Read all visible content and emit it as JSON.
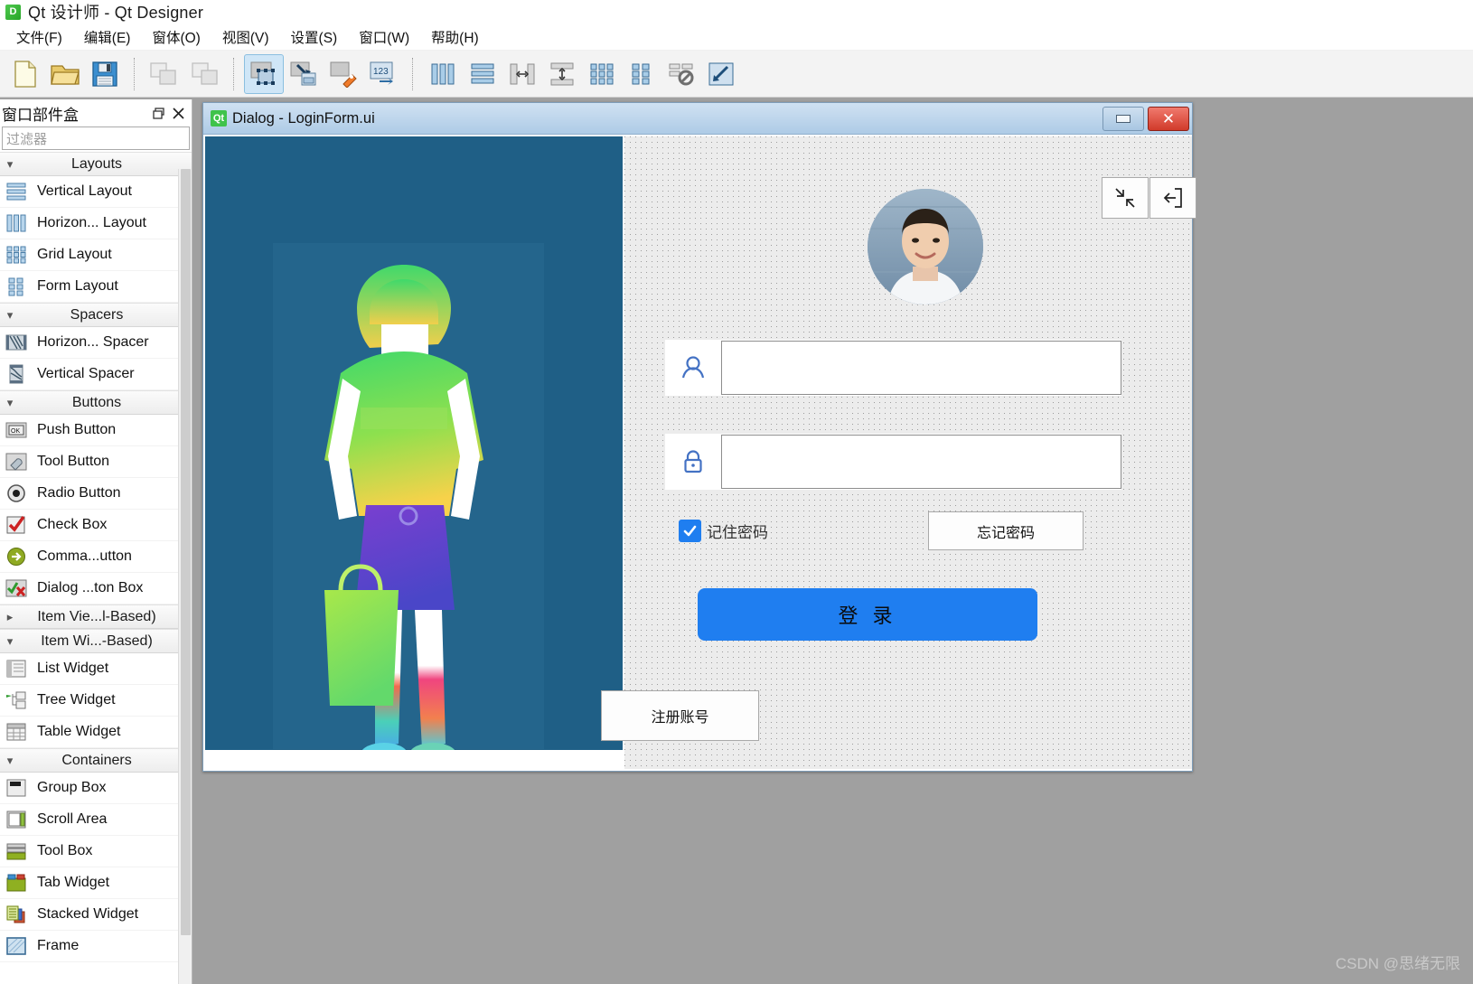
{
  "app": {
    "icon": "qt-designer-icon",
    "icon_text": "D",
    "title": "Qt 设计师 - Qt Designer"
  },
  "menubar": {
    "items": [
      {
        "label": "文件(F)",
        "name": "menu-file"
      },
      {
        "label": "编辑(E)",
        "name": "menu-edit"
      },
      {
        "label": "窗体(O)",
        "name": "menu-form"
      },
      {
        "label": "视图(V)",
        "name": "menu-view"
      },
      {
        "label": "设置(S)",
        "name": "menu-settings"
      },
      {
        "label": "窗口(W)",
        "name": "menu-window"
      },
      {
        "label": "帮助(H)",
        "name": "menu-help"
      }
    ]
  },
  "toolbar": {
    "groups": [
      [
        "new-file-icon",
        "open-file-icon",
        "save-file-icon"
      ],
      [
        "undo-icon",
        "redo-icon"
      ],
      [
        "edit-widgets-icon",
        "edit-signals-slots-icon",
        "edit-buddies-icon",
        "edit-tab-order-icon"
      ],
      [
        "layout-horizontally-icon",
        "layout-vertically-icon",
        "layout-splitter-horizontal-icon",
        "layout-splitter-vertical-icon",
        "layout-grid-icon",
        "layout-form-icon",
        "break-layout-icon",
        "adjust-size-icon"
      ]
    ]
  },
  "widgetbox": {
    "title": "窗口部件盒",
    "float_button": "float-icon",
    "close_button": "close-icon",
    "filter_placeholder": "过滤器",
    "sections": [
      {
        "label": "Layouts",
        "expanded": true,
        "items": [
          {
            "label": "Vertical Layout",
            "icon": "vertical-layout-icon"
          },
          {
            "label": "Horizon... Layout",
            "icon": "horizontal-layout-icon"
          },
          {
            "label": "Grid Layout",
            "icon": "grid-layout-icon"
          },
          {
            "label": "Form Layout",
            "icon": "form-layout-icon"
          }
        ]
      },
      {
        "label": "Spacers",
        "expanded": true,
        "items": [
          {
            "label": "Horizon... Spacer",
            "icon": "horizontal-spacer-icon"
          },
          {
            "label": "Vertical Spacer",
            "icon": "vertical-spacer-icon"
          }
        ]
      },
      {
        "label": "Buttons",
        "expanded": true,
        "items": [
          {
            "label": "Push Button",
            "icon": "push-button-icon"
          },
          {
            "label": "Tool Button",
            "icon": "tool-button-icon"
          },
          {
            "label": "Radio Button",
            "icon": "radio-button-icon"
          },
          {
            "label": "Check Box",
            "icon": "check-box-icon"
          },
          {
            "label": "Comma...utton",
            "icon": "command-link-button-icon"
          },
          {
            "label": "Dialog ...ton Box",
            "icon": "dialog-button-box-icon"
          }
        ]
      },
      {
        "label": "Item Vie...l-Based)",
        "expanded": false,
        "items": []
      },
      {
        "label": "Item Wi...-Based)",
        "expanded": true,
        "items": [
          {
            "label": "List Widget",
            "icon": "list-widget-icon"
          },
          {
            "label": "Tree Widget",
            "icon": "tree-widget-icon"
          },
          {
            "label": "Table Widget",
            "icon": "table-widget-icon"
          }
        ]
      },
      {
        "label": "Containers",
        "expanded": true,
        "items": [
          {
            "label": "Group Box",
            "icon": "group-box-icon"
          },
          {
            "label": "Scroll Area",
            "icon": "scroll-area-icon"
          },
          {
            "label": "Tool Box",
            "icon": "tool-box-icon"
          },
          {
            "label": "Tab Widget",
            "icon": "tab-widget-icon"
          },
          {
            "label": "Stacked Widget",
            "icon": "stacked-widget-icon"
          },
          {
            "label": "Frame",
            "icon": "frame-icon"
          }
        ]
      }
    ]
  },
  "dialog": {
    "icon_text": "Qt",
    "title": "Dialog - LoginForm.ui",
    "minimize_label": "minimize-icon",
    "close_label": "✕"
  },
  "login_form": {
    "collapse_button": "collapse-arrows-icon",
    "exit_button": "exit-icon",
    "avatar": "user-avatar-photo",
    "username": {
      "value": "",
      "placeholder": "",
      "icon": "user-icon"
    },
    "password": {
      "value": "",
      "placeholder": "",
      "icon": "lock-icon"
    },
    "remember": {
      "label": "记住密码",
      "checked": true
    },
    "forgot_button": "忘记密码",
    "login_button": "登 录",
    "register_button": "注册账号"
  },
  "watermark": "CSDN @思绪无限",
  "colors": {
    "accent_blue": "#1f7ef0",
    "icon_blue": "#4472c4",
    "promo_bg": "#1f5f86",
    "titlebar_blue": "#aecbe6",
    "canvas_gray": "#a0a0a0"
  }
}
